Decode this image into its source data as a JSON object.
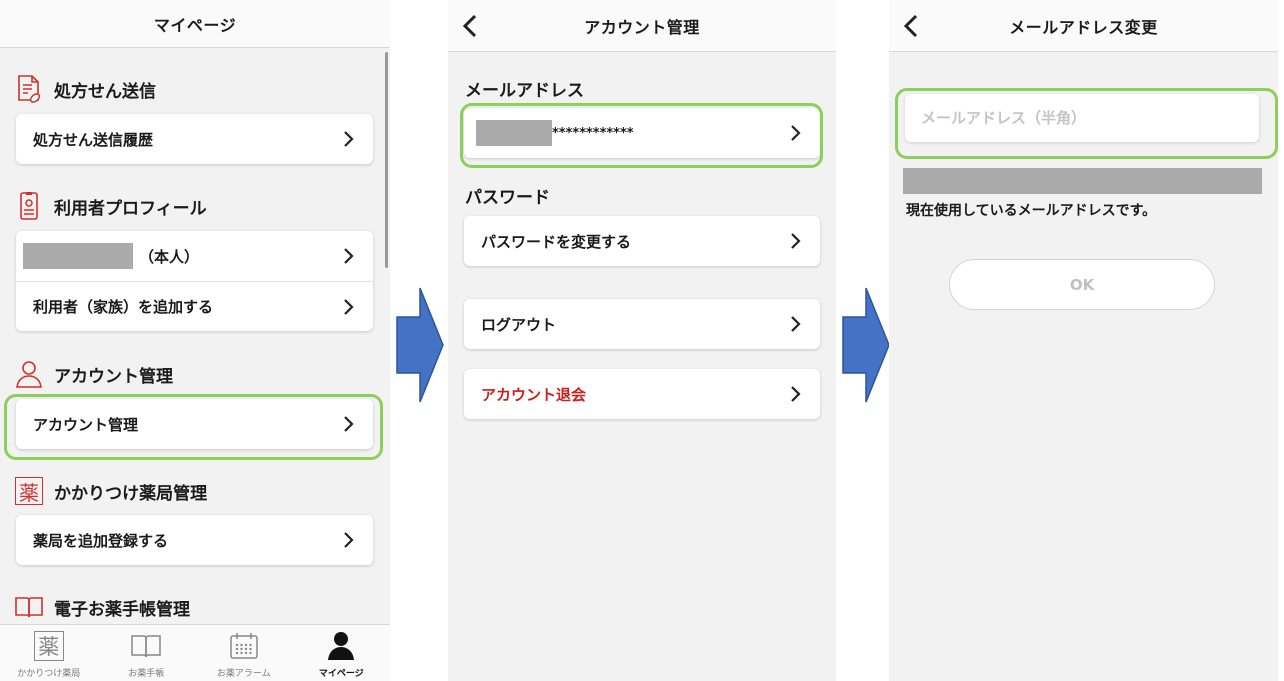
{
  "mypage": {
    "title": "マイページ",
    "sections": [
      {
        "title": "処方せん送信",
        "icon": "prescription-document-icon",
        "rows": [
          "処方せん送信履歴"
        ]
      },
      {
        "title": "利用者プロフィール",
        "icon": "user-profile-card-icon",
        "rows": [
          "（本人）",
          "利用者（家族）を追加する"
        ]
      },
      {
        "title": "アカウント管理",
        "icon": "person-outline-icon",
        "rows": [
          "アカウント管理"
        ]
      },
      {
        "title": "かかりつけ薬局管理",
        "icon": "pharmacy-kanji-icon",
        "icon_glyph": "薬",
        "rows": [
          "薬局を追加登録する"
        ]
      },
      {
        "title": "電子お薬手帳管理",
        "icon": "open-book-icon",
        "rows": []
      }
    ],
    "tabs": [
      {
        "label": "かかりつけ薬局",
        "icon": "pharmacy-kanji-icon",
        "glyph": "薬",
        "active": false
      },
      {
        "label": "お薬手帳",
        "icon": "book-icon",
        "active": false
      },
      {
        "label": "お薬アラーム",
        "icon": "calendar-icon",
        "active": false
      },
      {
        "label": "マイページ",
        "icon": "person-icon",
        "active": true
      }
    ]
  },
  "account": {
    "title": "アカウント管理",
    "email_section": "メールアドレス",
    "email_masked": "************",
    "password_section": "パスワード",
    "change_password": "パスワードを変更する",
    "logout": "ログアウト",
    "withdraw": "アカウント退会"
  },
  "email_change": {
    "title": "メールアドレス変更",
    "placeholder": "メールアドレス（半角）",
    "current_note": "現在使用しているメールアドレスです。",
    "ok_label": "OK"
  },
  "colors": {
    "accent_red": "#d0312d",
    "highlight_green": "#8ccf5a",
    "flow_arrow_blue": "#4472c4"
  }
}
